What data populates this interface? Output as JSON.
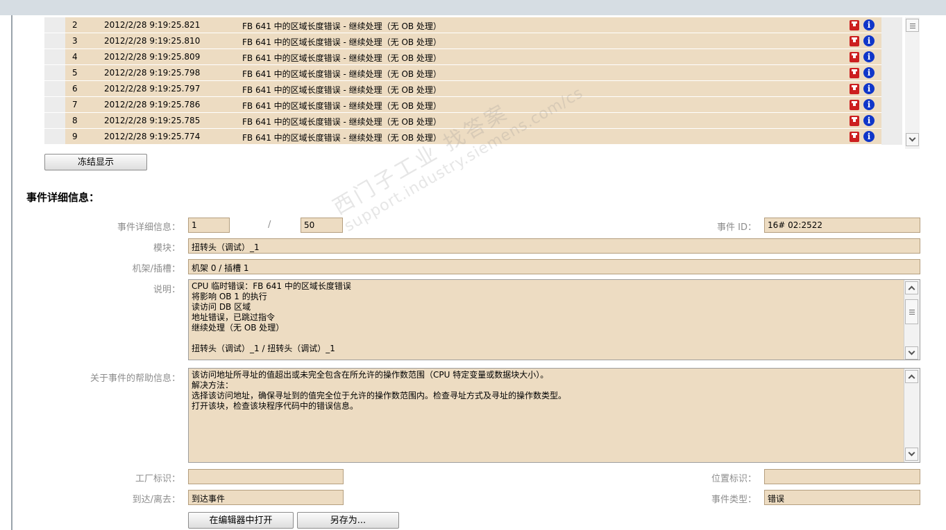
{
  "events": [
    {
      "num": "2",
      "time": "2012/2/28 9:19:25.821",
      "desc": "FB 641 中的区域长度错误 - 继续处理（无 OB 处理）"
    },
    {
      "num": "3",
      "time": "2012/2/28 9:19:25.810",
      "desc": "FB 641 中的区域长度错误 - 继续处理（无 OB 处理）"
    },
    {
      "num": "4",
      "time": "2012/2/28 9:19:25.809",
      "desc": "FB 641 中的区域长度错误 - 继续处理（无 OB 处理）"
    },
    {
      "num": "5",
      "time": "2012/2/28 9:19:25.798",
      "desc": "FB 641 中的区域长度错误 - 继续处理（无 OB 处理）"
    },
    {
      "num": "6",
      "time": "2012/2/28 9:19:25.797",
      "desc": "FB 641 中的区域长度错误 - 继续处理（无 OB 处理）"
    },
    {
      "num": "7",
      "time": "2012/2/28 9:19:25.786",
      "desc": "FB 641 中的区域长度错误 - 继续处理（无 OB 处理）"
    },
    {
      "num": "8",
      "time": "2012/2/28 9:19:25.785",
      "desc": "FB 641 中的区域长度错误 - 继续处理（无 OB 处理）"
    },
    {
      "num": "9",
      "time": "2012/2/28 9:19:25.774",
      "desc": "FB 641 中的区域长度错误 - 继续处理（无 OB 处理）"
    }
  ],
  "freeze_button": "冻结显示",
  "section_title": "事件详细信息：",
  "detail": {
    "labels": {
      "event_detail": "事件详细信息：",
      "event_id": "事件 ID：",
      "module": "模块：",
      "rack_slot": "机架/插槽：",
      "description": "说明：",
      "help": "关于事件的帮助信息：",
      "plant_id": "工厂标识：",
      "location_id": "位置标识：",
      "coming_going": "到达/离去：",
      "event_type": "事件类型："
    },
    "index": "1",
    "separator": "/",
    "total": "50",
    "event_id": "16# 02:2522",
    "module": "扭转头（调试）_1",
    "rack_slot": "机架 0 / 插槽 1",
    "description_lines": [
      "CPU 临时错误：FB 641 中的区域长度错误",
      "将影响 OB 1 的执行",
      "读访问 DB 区域",
      "地址错误，已跳过指令",
      " 继续处理（无 OB 处理）",
      "",
      "扭转头（调试）_1 / 扭转头（调试）_1"
    ],
    "help_lines": [
      "该访问地址所寻址的值超出或未完全包含在所允许的操作数范围（CPU 特定变量或数据块大小）。",
      "解决方法：",
      "选择该访问地址，确保寻址到的值完全位于允许的操作数范围内。检查寻址方式及寻址的操作数类型。",
      "打开该块，检查该块程序代码中的错误信息。"
    ],
    "plant_id": "",
    "location_id": "",
    "coming_going": "到达事件",
    "event_type": "错误"
  },
  "buttons": {
    "open_in_editor": "在编辑器中打开",
    "save_as": "另存为..."
  },
  "icons": [
    "diagnostic-icon",
    "info-icon",
    "scroll-up-icon",
    "scroll-down-icon",
    "scroll-grip-icon"
  ],
  "colors": {
    "field_bg": "#eddcc2",
    "diag_red": "#cc1f1f",
    "info_blue": "#1036c9"
  },
  "watermark": {
    "line1": "西门子工业 找答案",
    "line2": "support.industry.siemens.com/cs"
  }
}
